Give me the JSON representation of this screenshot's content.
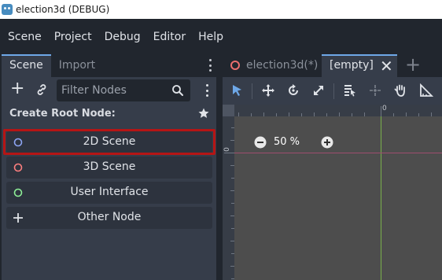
{
  "window": {
    "title": "election3d (DEBUG)"
  },
  "menu": [
    "Scene",
    "Project",
    "Debug",
    "Editor",
    "Help"
  ],
  "dock": {
    "tabs": {
      "active": "Scene",
      "inactive": "Import"
    },
    "filter_placeholder": "Filter Nodes",
    "create_root_label": "Create Root Node:",
    "buttons": [
      {
        "label": "2D Scene",
        "icon": "node2d-icon",
        "color": "#8da5f3"
      },
      {
        "label": "3D Scene",
        "icon": "node3d-icon",
        "color": "#fc7f7f"
      },
      {
        "label": "User Interface",
        "icon": "control-icon",
        "color": "#8eef97"
      },
      {
        "label": "Other Node",
        "icon": "add-icon",
        "color": "#e0e3e8"
      }
    ],
    "highlighted_button": "2D Scene"
  },
  "scene_tabs": [
    {
      "label": "election3d(*)",
      "active": false,
      "icon": "node3d-icon"
    },
    {
      "label": "[empty]",
      "active": true,
      "close": "✕"
    }
  ],
  "viewport": {
    "zoom_label": "50 %",
    "ruler_top_label": "0",
    "ruler_left_label": "0"
  },
  "colors": {
    "accent": "#6ea8e8",
    "highlight_box": "#b51515",
    "axis_x": "#9e4c6e",
    "axis_y": "#79b14a"
  }
}
